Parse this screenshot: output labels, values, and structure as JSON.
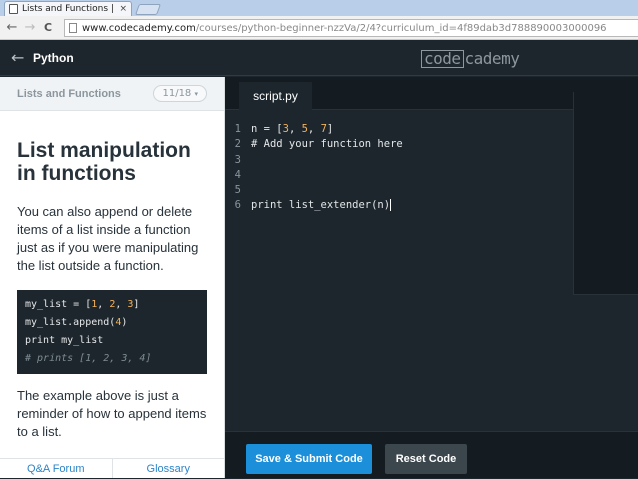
{
  "browser": {
    "tab_title": "Lists and Functions | Code",
    "tab_close": "×",
    "url_host": "www.codecademy.com",
    "url_path": "/courses/python-beginner-nzzVa/2/4?curriculum_id=4f89dab3d788890003000096",
    "back_icon": "←",
    "forward_icon": "→",
    "reload_icon": "C"
  },
  "header": {
    "back_icon": "←",
    "course_title": "Python",
    "logo_box": "code",
    "logo_rest": "cademy"
  },
  "lesson": {
    "section_title": "Lists and Functions",
    "progress": "11/18",
    "progress_caret": "▾",
    "exercise_title": "List manipulation in functions",
    "paragraph1": "You can also append or delete items of a list inside a function just as if you were manipulating the list outside a function.",
    "paragraph2": "The example above is just a reminder of how to append items to a list.",
    "snippet": {
      "line1_a": "my_list = [",
      "line1_n1": "1",
      "line1_s1": ", ",
      "line1_n2": "2",
      "line1_s2": ", ",
      "line1_n3": "3",
      "line1_b": "]",
      "line2_a": "my_list.append(",
      "line2_n": "4",
      "line2_b": ")",
      "line3": "print my_list",
      "line4": "# prints [1, 2, 3, 4]"
    },
    "footer": {
      "forum_label": "Q&A Forum",
      "glossary_label": "Glossary"
    }
  },
  "editor": {
    "file_tab": "script.py",
    "lines": {
      "l1_num": "1",
      "l1_a": "n = [",
      "l1_n1": "3",
      "l1_s1": ", ",
      "l1_n2": "5",
      "l1_s2": ", ",
      "l1_n3": "7",
      "l1_b": "]",
      "l2_num": "2",
      "l2_text": "# Add your function here",
      "l3_num": "3",
      "l4_num": "4",
      "l5_num": "5",
      "l6_num": "6",
      "l6_text": "print list_extender(n)"
    },
    "submit_label": "Save & Submit Code",
    "reset_label": "Reset Code"
  },
  "colors": {
    "accent": "#1b8fd9",
    "editor_bg": "#1d262c",
    "number": "#f3b35b"
  }
}
